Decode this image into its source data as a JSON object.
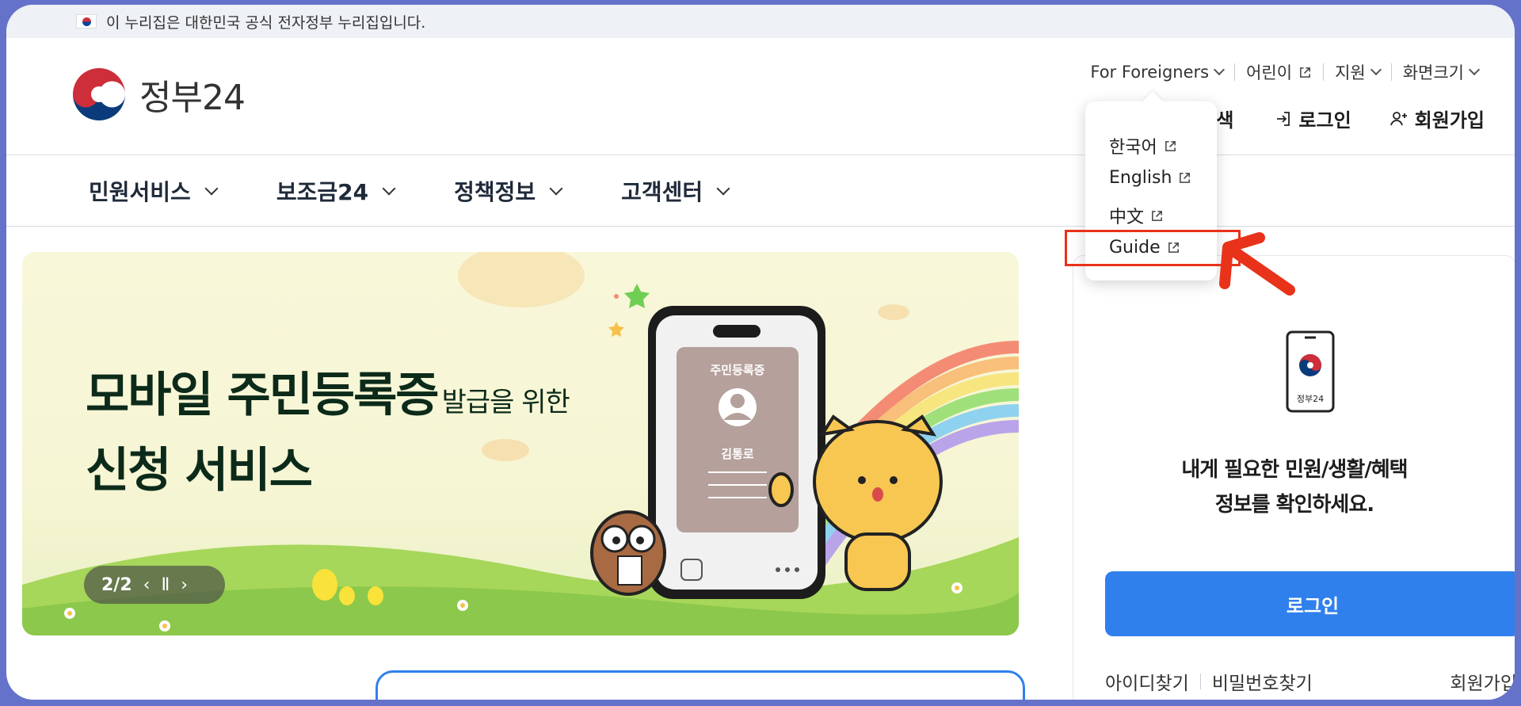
{
  "notice": {
    "text": "이 누리집은 대한민국 공식 전자정부 누리집입니다."
  },
  "logo": {
    "text": "정부24"
  },
  "util_nav": {
    "foreigners": "For Foreigners",
    "kids": "어린이",
    "support": "지원",
    "screen_size": "화면크기"
  },
  "account": {
    "partial_label": "색",
    "login": "로그인",
    "signup": "회원가입"
  },
  "gnb": {
    "items": [
      "민원서비스",
      "보조금24",
      "정책정보",
      "고객센터"
    ]
  },
  "banner": {
    "headline_bold": "모바일 주민등록증",
    "headline_small": "발급을 위한",
    "headline_line2": "신청 서비스",
    "pager": "2/2",
    "card_title": "주민등록증",
    "card_name": "김통로"
  },
  "panel": {
    "phone_label": "정부24",
    "title_line1": "내게 필요한 민원/생활/혜택",
    "title_line2": "정보를 확인하세요.",
    "login_button": "로그인",
    "find_id": "아이디찾기",
    "find_pw": "비밀번호찾기",
    "signup": "회원가입"
  },
  "dropdown": {
    "items": [
      "한국어",
      "English",
      "中文",
      "Guide"
    ]
  },
  "colors": {
    "accent": "#2f80ed",
    "annotation": "#e8321a",
    "frame": "#6572c9"
  }
}
